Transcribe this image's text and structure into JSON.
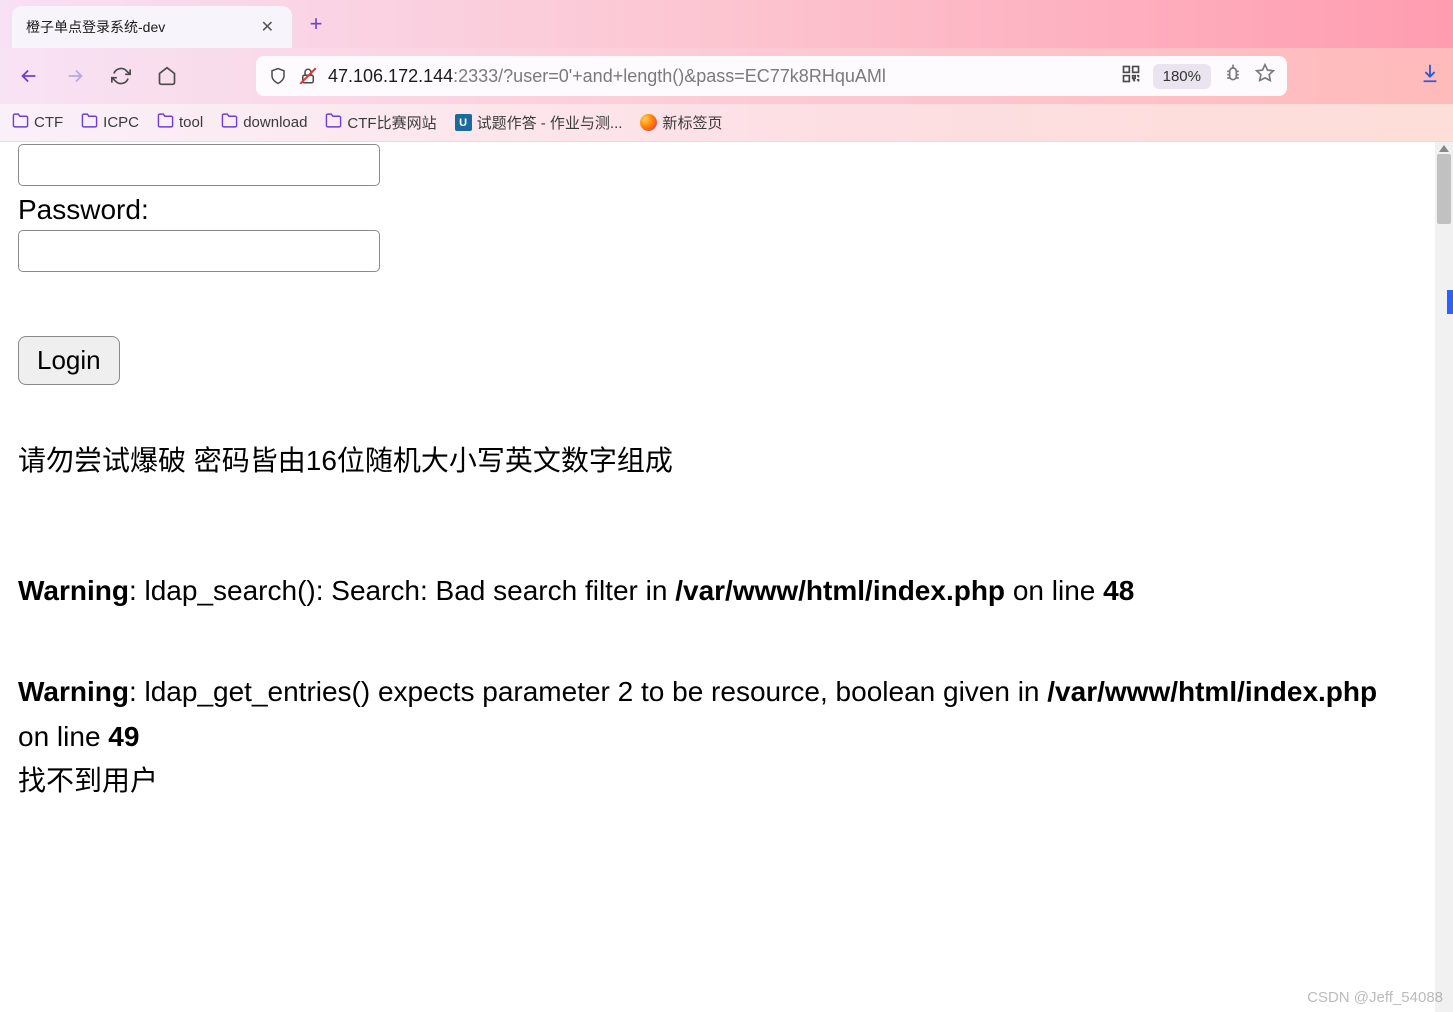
{
  "tab": {
    "title": "橙子单点登录系统-dev"
  },
  "url": {
    "host": "47.106.172.144",
    "rest": ":2333/?user=0'+and+length()&pass=EC77k8RHquAMl"
  },
  "zoom": "180%",
  "bookmarks": {
    "ctf": "CTF",
    "icpc": "ICPC",
    "tool": "tool",
    "download": "download",
    "ctfsite": "CTF比赛网站",
    "uoj": "试题作答 - 作业与测...",
    "newtab": "新标签页"
  },
  "form": {
    "password_label": "Password:",
    "login_label": "Login"
  },
  "notice": "请勿尝试爆破 密码皆由16位随机大小写英文数字组成",
  "warning1": {
    "prefix": "Warning",
    "msg": ": ldap_search(): Search: Bad search filter in ",
    "path": "/var/www/html/index.php",
    "online": " on line ",
    "line": "48"
  },
  "warning2": {
    "prefix": "Warning",
    "msg": ": ldap_get_entries() expects parameter 2 to be resource, boolean given in ",
    "path": "/var/www/html/index.php",
    "online": " on line ",
    "line": "49"
  },
  "notfound": "找不到用户",
  "watermark": "CSDN @Jeff_54088"
}
